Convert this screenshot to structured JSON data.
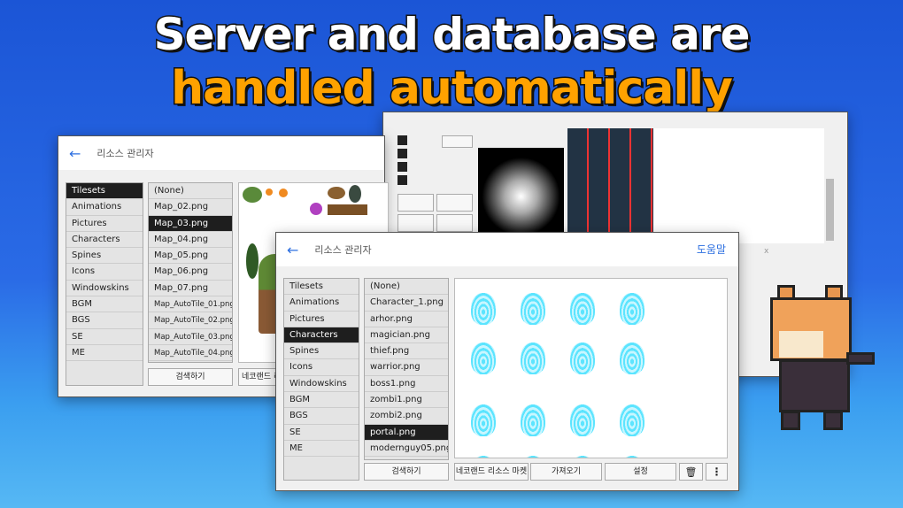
{
  "headline": {
    "line1": "Server and database are",
    "line2": "handled automatically"
  },
  "colors": {
    "accent": "#2d6fe0",
    "headline_orange": "#ffa200",
    "selected": "#1e1e1e",
    "background": "#2a6be6",
    "portal": "#3fe0ff"
  },
  "back_window": {
    "title": "리소스 관리자",
    "categories": [
      "Tilesets",
      "Animations",
      "Pictures",
      "Characters",
      "Spines",
      "Icons",
      "Windowskins",
      "BGM",
      "BGS",
      "SE",
      "ME"
    ],
    "selected_category": "Tilesets",
    "files": [
      "(None)",
      "Map_02.png",
      "Map_03.png",
      "Map_04.png",
      "Map_05.png",
      "Map_06.png",
      "Map_07.png",
      "Map_AutoTile_01.png",
      "Map_AutoTile_02.png",
      "Map_AutoTile_03.png",
      "Map_AutoTile_04.png"
    ],
    "selected_file": "Map_03.png",
    "search_label": "검색하기",
    "market_label": "네코랜드 리"
  },
  "front_window": {
    "title": "리소스 관리자",
    "help_label": "도움말",
    "categories": [
      "Tilesets",
      "Animations",
      "Pictures",
      "Characters",
      "Spines",
      "Icons",
      "Windowskins",
      "BGM",
      "BGS",
      "SE",
      "ME"
    ],
    "selected_category": "Characters",
    "files": [
      "(None)",
      "Character_1.png",
      "arhor.png",
      "magician.png",
      "thief.png",
      "warrior.png",
      "boss1.png",
      "zombi1.png",
      "zombi2.png",
      "portal.png",
      "modernguy05.png"
    ],
    "selected_file": "portal.png",
    "search_label": "검색하기",
    "market_label": "네코랜드 리소스 마켓",
    "import_label": "가져오기",
    "settings_label": "설정",
    "icons": {
      "back": "arrow-left-icon",
      "trash": "trash-icon",
      "more": "more-vertical-icon"
    }
  },
  "mid_window": {
    "help_label": "도움말",
    "x_label": "x"
  }
}
